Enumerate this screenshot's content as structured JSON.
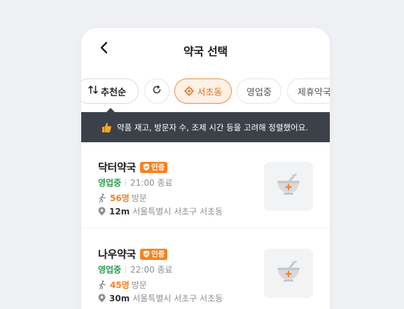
{
  "header": {
    "title": "약국 선택"
  },
  "filters": {
    "sort_label": "추천순",
    "sort_icon": "sort-arrows-icon",
    "refresh_icon": "refresh-icon",
    "location_label": "서초동",
    "open_label": "영업중",
    "partner_label": "제휴약국"
  },
  "tooltip": {
    "text": "약품 재고, 방문자 수, 조제 시간 등을 고려해 정렬했어요."
  },
  "colors": {
    "accent": "#f7821e",
    "open_status": "#1fa04a",
    "tooltip_bg": "#3c4149"
  },
  "pharmacies": [
    {
      "name": "닥터약국",
      "badge": "인증",
      "status": "영업중",
      "close_time": "21:00 종료",
      "visit_count": "56명",
      "visit_suffix": "방문",
      "distance": "12m",
      "address": "서울특별시 서초구 서초동"
    },
    {
      "name": "나우약국",
      "badge": "인증",
      "status": "영업중",
      "close_time": "22:00 종료",
      "visit_count": "45명",
      "visit_suffix": "방문",
      "distance": "30m",
      "address": "서울특별시 서초구 서초동"
    }
  ]
}
